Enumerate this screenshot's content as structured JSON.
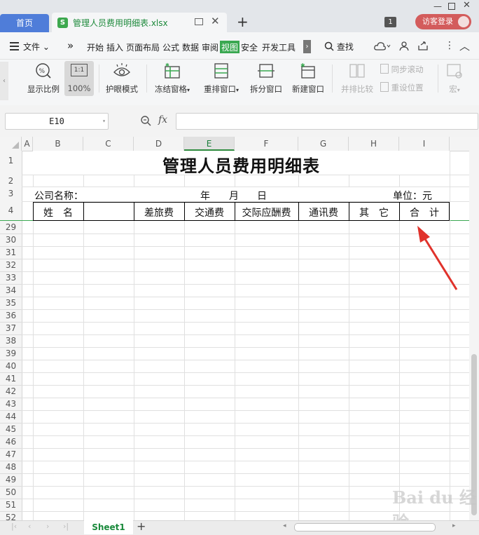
{
  "titlebar": {
    "home_tab": "首页",
    "file_tab": "管理人员费用明细表.xlsx",
    "excel_badge": "S",
    "tab_count": "1",
    "login": "访客登录"
  },
  "menubar": {
    "file_menu": "文件",
    "chevron": "»",
    "tabs": [
      "开始",
      "插入",
      "页面布局",
      "公式",
      "数据",
      "审阅",
      "视图",
      "安全",
      "开发工具"
    ],
    "active_tab": "视图",
    "search": "查找"
  },
  "toolbar": {
    "display_ratio": "显示比例",
    "zoom_value": "100%",
    "eye_mode": "护眼模式",
    "freeze_panes": "冻结窗格",
    "rearrange_windows": "重排窗口",
    "split_window": "拆分窗口",
    "new_window": "新建窗口",
    "side_by_side": "并排比较",
    "sync_scroll": "同步滚动",
    "reset_position": "重设位置",
    "macro": "宏",
    "zoom_icon_text": "1:1"
  },
  "formula_bar": {
    "cell_ref": "E10",
    "fx": "fx",
    "value": ""
  },
  "grid": {
    "columns": [
      "A",
      "B",
      "C",
      "D",
      "E",
      "F",
      "G",
      "H",
      "I"
    ],
    "selected_column": "E",
    "top_rows": [
      "1",
      "2",
      "3",
      "4"
    ],
    "rows": [
      "29",
      "30",
      "31",
      "32",
      "33",
      "34",
      "35",
      "36",
      "37",
      "38",
      "39",
      "40",
      "41",
      "42",
      "43",
      "44",
      "45",
      "46",
      "47",
      "48",
      "49",
      "50",
      "51",
      "52"
    ]
  },
  "sheet": {
    "title": "管理人员费用明细表",
    "company_label": "公司名称：",
    "date_year": "年",
    "date_month": "月",
    "date_day": "日",
    "unit_label": "单位：元",
    "headers": [
      "姓　名",
      "",
      "差旅费",
      "交通费",
      "交际应酬费",
      "通讯费",
      "其　它",
      "合　计"
    ]
  },
  "bottom": {
    "sheet_tab": "Sheet1",
    "add_sheet": "+"
  },
  "watermark": "Bai du 经验",
  "colors": {
    "accent_green": "#3aa851",
    "home_blue": "#4f7dd9",
    "login_red": "#d35c5c",
    "arrow_red": "#e0322b"
  }
}
